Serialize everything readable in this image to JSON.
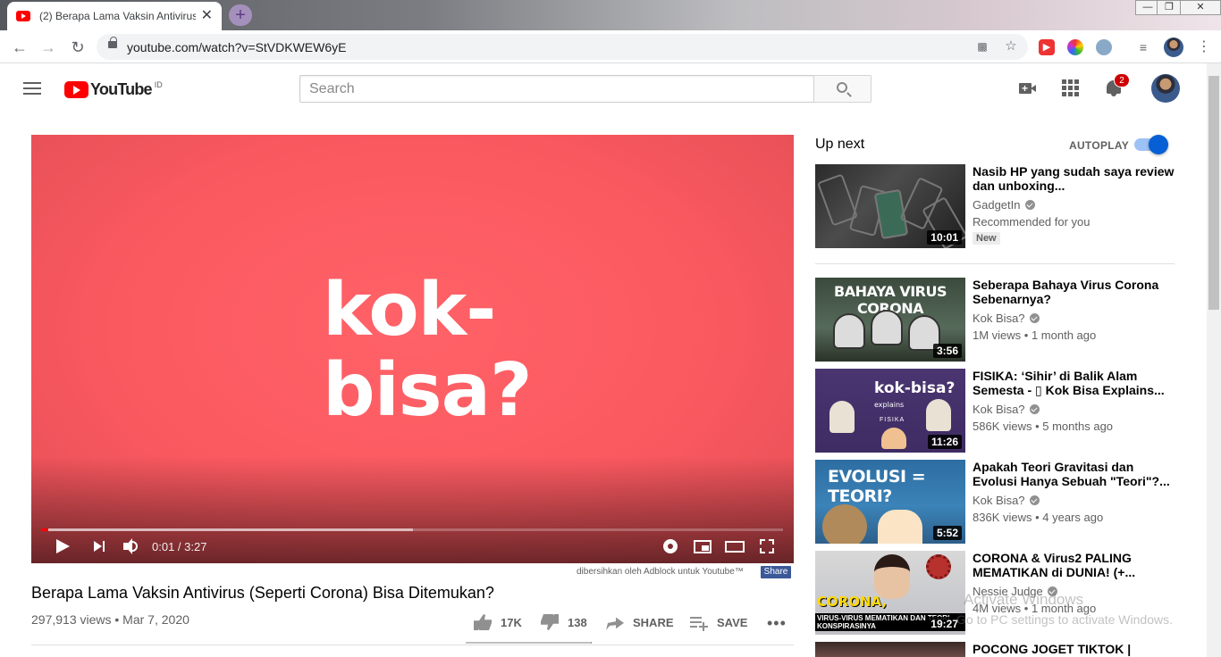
{
  "browser": {
    "tab_title": "(2) Berapa Lama Vaksin Antivirus",
    "tab_close": "✕",
    "new_tab": "+",
    "url": "youtube.com/watch?v=StVDKWEW6yE",
    "window_controls": {
      "minimize": "—",
      "restore": "❐",
      "close": "✕"
    }
  },
  "masthead": {
    "logo_text": "YouTube",
    "country_code": "ID",
    "search_placeholder": "Search",
    "notification_count": "2"
  },
  "player": {
    "overlay_text_line1": "kok-",
    "overlay_text_line2": "bisa?",
    "time": "0:01 / 3:27",
    "played_fraction": 0.008,
    "buffered_fraction": 0.5,
    "background_color": "#fb5960"
  },
  "adblock": {
    "note": "dibersihkan oleh Adblock untuk Youtube™",
    "share_label": "Share"
  },
  "video": {
    "title": "Berapa Lama Vaksin Antivirus (Seperti Corona) Bisa Ditemukan?",
    "views_date": "297,913 views • Mar 7, 2020",
    "likes": "17K",
    "dislikes": "138",
    "share_label": "SHARE",
    "save_label": "SAVE",
    "more_label": "•••",
    "like_ratio": 0.99
  },
  "sidebar": {
    "up_next_label": "Up next",
    "autoplay_label": "AUTOPLAY",
    "autoplay_on": true,
    "recommendations": [
      {
        "title": "Nasib HP yang sudah saya review dan unboxing...",
        "channel": "GadgetIn",
        "stats": "Recommended for you",
        "badge": "New",
        "duration": "10:01"
      },
      {
        "title": "Seberapa Bahaya Virus Corona Sebenarnya?",
        "channel": "Kok Bisa?",
        "stats": "1M views • 1 month ago",
        "duration": "3:56",
        "thumb_caption": "BAHAYA VIRUS CORONA"
      },
      {
        "title": "FISIKA: ‘Sihir’ di Balik Alam Semesta - ▯ Kok Bisa Explains...",
        "channel": "Kok Bisa?",
        "stats": "586K views • 5 months ago",
        "duration": "11:26",
        "thumb_caption": "kok-bisa?",
        "thumb_caption_small": "explains",
        "thumb_tag": "FISIKA"
      },
      {
        "title": "Apakah Teori Gravitasi dan Evolusi Hanya Sebuah \"Teori\"?...",
        "channel": "Kok Bisa?",
        "stats": "836K views • 4 years ago",
        "duration": "5:52",
        "thumb_caption": "EVOLUSI = TEORI?"
      },
      {
        "title": "CORONA & Virus2 PALING MEMATIKAN di DUNIA! (+...",
        "channel": "Nessie Judge",
        "stats": "4M views • 1 month ago",
        "duration": "19:27",
        "thumb_caption": "CORONA,",
        "thumb_sub": "VIRUS-VIRUS MEMATIKAN DAN TEORI KONSPIRASINYA"
      },
      {
        "title": "POCONG JOGET TIKTOK |",
        "channel": "",
        "stats": "",
        "duration": ""
      }
    ]
  },
  "watermark": {
    "line1": "Activate Windows",
    "line2": "Go to PC settings to activate Windows."
  }
}
